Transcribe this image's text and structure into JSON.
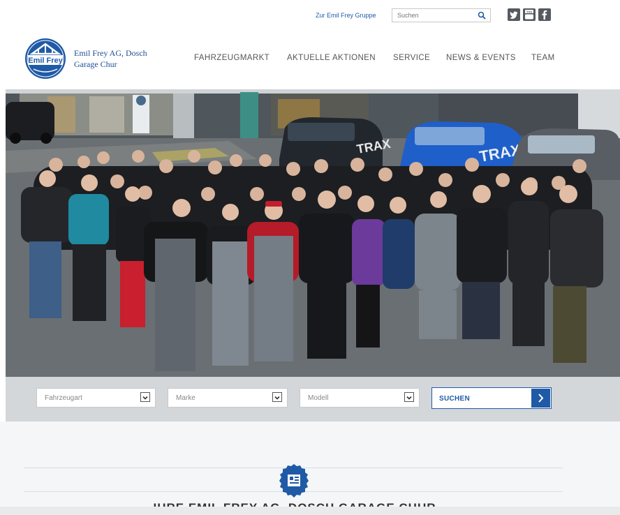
{
  "topbar": {
    "group_link": "Zur Emil Frey Gruppe",
    "search_placeholder": "Suchen",
    "social_icons": [
      "twitter-icon",
      "youtube-icon",
      "facebook-icon"
    ],
    "social_labels": {
      "youtube": "You"
    }
  },
  "header": {
    "logo_text": "Emil Frey",
    "brand_line1": "Emil Frey AG, Dosch",
    "brand_line2": "Garage Chur",
    "nav": [
      "FAHRZEUGMARKT",
      "AKTUELLE AKTIONEN",
      "SERVICE",
      "NEWS & EVENTS",
      "TEAM"
    ]
  },
  "hero": {
    "car_label": "TRAX"
  },
  "filter": {
    "fields": [
      {
        "label": "Fahrzeugart"
      },
      {
        "label": "Marke"
      },
      {
        "label": "Modell"
      }
    ],
    "search_label": "SUCHEN"
  },
  "intro": {
    "title": "IHRE EMIL FREY AG, DOSCH GARAGE CHUR"
  },
  "colors": {
    "brand_blue": "#1f5aa6",
    "filter_bg": "#d3d7da",
    "intro_bg": "#f4f6f8"
  }
}
